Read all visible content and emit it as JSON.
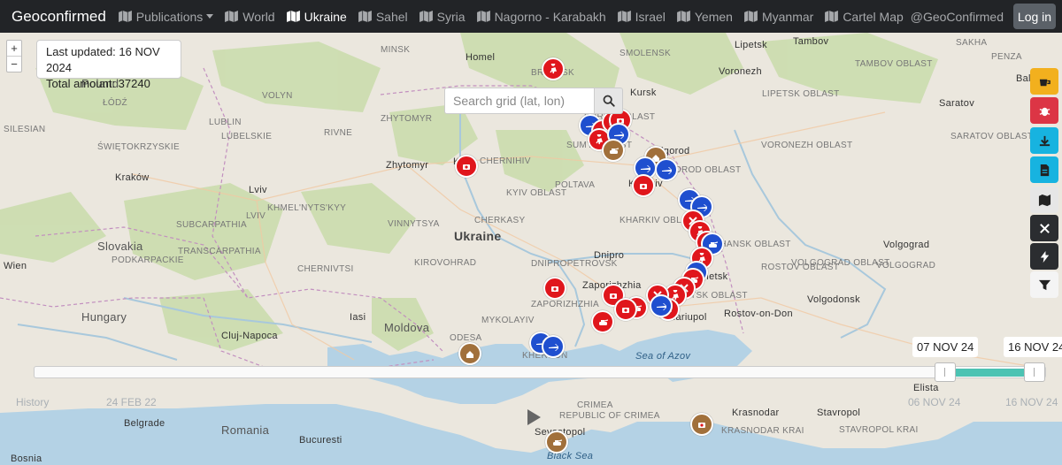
{
  "brand": "Geoconfirmed",
  "nav": [
    {
      "label": "Publications",
      "icon": "map-icon",
      "dropdown": true,
      "active": false
    },
    {
      "label": "World",
      "icon": "map-icon",
      "active": false
    },
    {
      "label": "Ukraine",
      "icon": "map-icon",
      "active": true
    },
    {
      "label": "Sahel",
      "icon": "map-icon",
      "active": false
    },
    {
      "label": "Syria",
      "icon": "map-icon",
      "active": false
    },
    {
      "label": "Nagorno - Karabakh",
      "icon": "map-icon",
      "active": false
    },
    {
      "label": "Israel",
      "icon": "map-icon",
      "active": false
    },
    {
      "label": "Yemen",
      "icon": "map-icon",
      "active": false
    },
    {
      "label": "Myanmar",
      "icon": "map-icon",
      "active": false
    },
    {
      "label": "Cartel Map",
      "icon": "map-icon",
      "active": false
    }
  ],
  "handle": "@GeoConfirmed",
  "login_label": "Log in",
  "info": {
    "last_updated": "Last updated: 16 NOV 2024",
    "total": "Total amount: 37240"
  },
  "search": {
    "placeholder": "Search grid (lat, lon)"
  },
  "zoom": {
    "in": "+",
    "out": "−"
  },
  "toolbar": [
    {
      "icon": "coffee-icon",
      "color": "#f2b01e"
    },
    {
      "icon": "bug-icon",
      "color": "#dc3545"
    },
    {
      "icon": "download-icon",
      "color": "#17b3e0"
    },
    {
      "icon": "file-icon",
      "color": "#17b3e0"
    },
    {
      "icon": "map-icon",
      "color": "#e6e6e6"
    },
    {
      "icon": "crossed-tools-icon",
      "color": "#2b2d30"
    },
    {
      "icon": "lightning-icon",
      "color": "#2b2d30"
    },
    {
      "icon": "filter-icon",
      "color": "#f4f4f4"
    }
  ],
  "timeline": {
    "start_tip": "07 NOV 24",
    "end_tip": "16 NOV 24",
    "axis": [
      "History",
      "24 FEB 22",
      "06 NOV 24",
      "16 NOV 24"
    ]
  },
  "labels": {
    "countries": [
      "Poland",
      "Ukraine",
      "Slovakia",
      "Hungary",
      "Moldova",
      "Romania"
    ],
    "cities": [
      "Homel",
      "Kursk",
      "Lipetsk",
      "Tambov",
      "Voronezh",
      "Balakovo",
      "Saratov",
      "Zhytomyr",
      "Kyiv",
      "Lviv",
      "Kraków",
      "Wien",
      "Dnipro",
      "Zaporizhzhia",
      "Mariupol",
      "Rostov-on-Don",
      "Volgograd",
      "Volgodonsk",
      "Elista",
      "Krasnodar",
      "Stavropol",
      "Sevastopol",
      "Belgrade",
      "Bucuresti",
      "Cluj-Napoca",
      "Iasi",
      "Bosnia",
      "Belgorod",
      "Kharkiv",
      "Donetsk"
    ],
    "regions": [
      "LUBLIN",
      "VOLYN",
      "RIVNE",
      "LVIV",
      "ZHYTOMYR",
      "KHMEL'NYTS'KYY",
      "VINNYTSYA",
      "CHERKASY",
      "KIROVOHRAD",
      "POLTAVA",
      "CHERNIHIV",
      "SUMY OBLAST",
      "KHARKIV OBLAST",
      "LUHANSK OBLAST",
      "VORONEZH OBLAST",
      "ROSTOV OBLAST",
      "VOLGOGRAD OBLAST",
      "MYKOLAYIV",
      "ODESA",
      "ŚWIĘTOKRZYSKIE",
      "LUBELSKIE",
      "SUBCARPATHIA",
      "TRANSCARPATHIA",
      "CHERNIVTSI",
      "KRASNODAR KRAI",
      "STAVROPOL KRAI",
      "PODKARPACKIE",
      "ŁÓDŹ",
      "BELGOROD OBLAST",
      "KURSK OBLAST",
      "LIPETSK OBLAST",
      "TAMBOV OBLAST",
      "BRYANSK",
      "MINSK",
      "SILESIAN",
      "SMOLENSK",
      "KYIV OBLAST",
      "ZAPORIZHZHIA",
      "DNIPROPETROVSK",
      "KHERSON",
      "CRIMEA",
      "REPUBLIC OF CRIMEA",
      "SAKHA",
      "DONETSK OBLAST",
      "VOLGOGRAD",
      "SARATOV OBLAST",
      "PENZA"
    ],
    "seas": [
      "Sea of Azov",
      "Black Sea"
    ]
  }
}
